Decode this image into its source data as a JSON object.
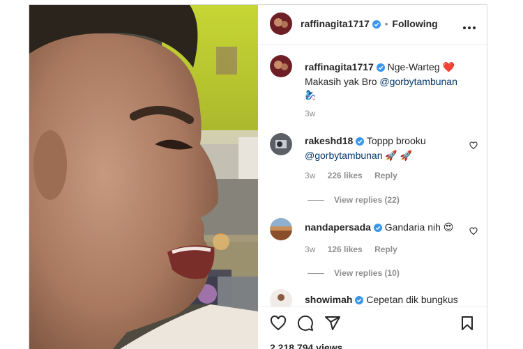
{
  "header": {
    "username": "raffinagita1717",
    "separator": "•",
    "follow_status": "Following",
    "more_icon": "more-horizontal-icon"
  },
  "caption": {
    "username": "raffinagita1717",
    "text_part1": "Nge-Warteg",
    "heart_emoji": "❤️",
    "text_part2": "Makasih yak Bro",
    "mention": "@gorbytambunan",
    "emoji_line": "🧞‍♀️",
    "time": "3w"
  },
  "comments": [
    {
      "username": "rakeshd18",
      "text_part1": "Toppp brooku",
      "mention": "@gorbytambunan",
      "emojis": "🚀 🚀",
      "time": "3w",
      "likes": "226 likes",
      "reply_label": "Reply",
      "view_replies": "View replies (22)"
    },
    {
      "username": "nandapersada",
      "text_part1": "Gandaria nih",
      "emojis": "😍",
      "time": "3w",
      "likes": "126 likes",
      "reply_label": "Reply",
      "view_replies": "View replies (10)"
    },
    {
      "username": "showimah",
      "text_part1": "Cepetan dik bungkus"
    }
  ],
  "actions": {
    "icons": [
      "heart-icon",
      "comment-icon",
      "share-icon",
      "bookmark-icon"
    ],
    "views": "2,218,794 views"
  },
  "colors": {
    "verified": "#3897f0",
    "link": "#00376b",
    "muted": "#8e8e8e",
    "text": "#262626",
    "heart": "#ed4956"
  }
}
